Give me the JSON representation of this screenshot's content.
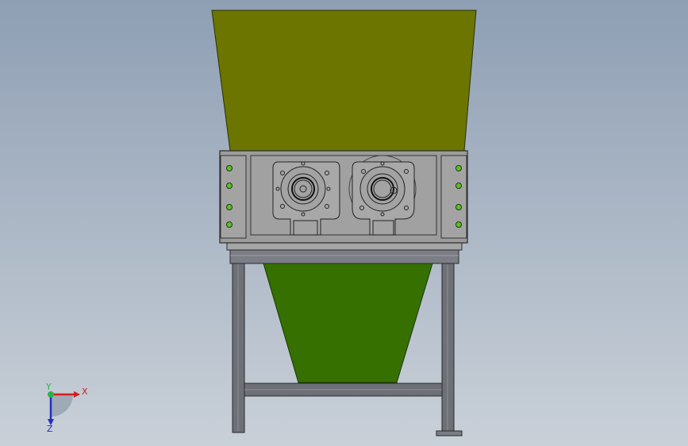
{
  "viewport": {
    "background_top": "#8e9fb4",
    "background_bottom": "#c9d0d8"
  },
  "model": {
    "hopper_color": "#6b7500",
    "chute_color": "#367000",
    "housing_color": "#9c9c9c",
    "frame_color": "#6e7078",
    "bolt_color": "#5cbf2a"
  },
  "triad": {
    "x_label": "X",
    "y_label": "Y",
    "z_label": "Z",
    "x_color": "#d21e1e",
    "y_color": "#2bb24c",
    "z_color": "#2030c0"
  }
}
